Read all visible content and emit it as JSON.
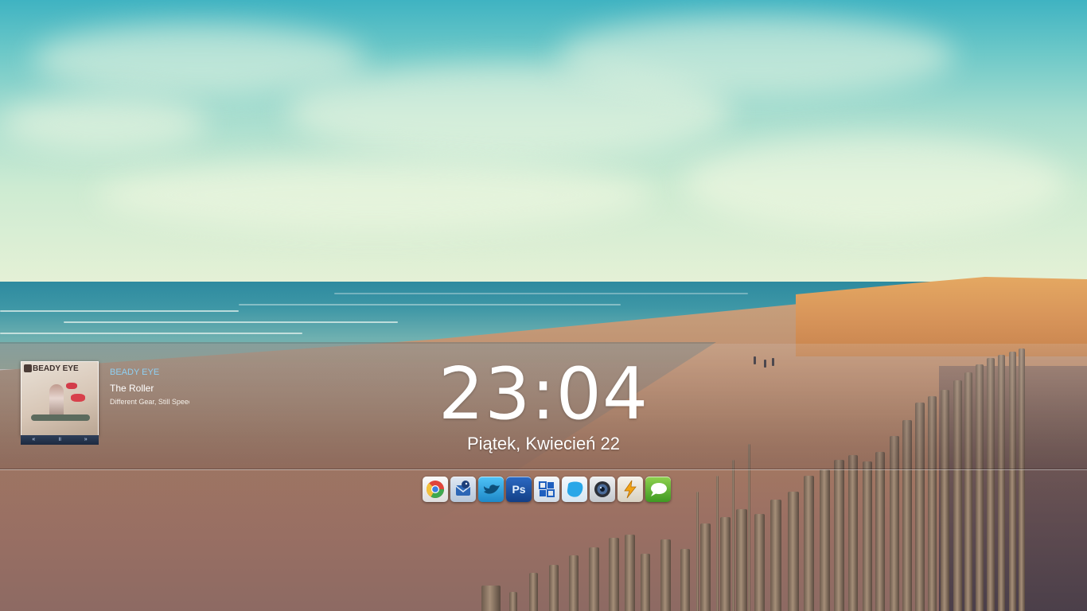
{
  "clock": {
    "time": "23:04",
    "date": "Piątek, Kwiecień 22"
  },
  "music_player": {
    "artist": "BEADY EYE",
    "title": "The Roller",
    "album": "Different Gear, Still Speeding",
    "album_art_text": "BEADY EYE",
    "controls": {
      "previous": "«",
      "play_pause": "॥",
      "next": "»"
    }
  },
  "dock": {
    "apps": [
      {
        "icon": "chrome-icon",
        "label": "Google Chrome"
      },
      {
        "icon": "thunderbird-icon",
        "label": "Thunderbird"
      },
      {
        "icon": "twitter-bird-icon",
        "label": "Twitter"
      },
      {
        "icon": "photoshop-icon",
        "label": "Ps"
      },
      {
        "icon": "windows-icon",
        "label": "Windows"
      },
      {
        "icon": "skype-icon",
        "label": "Skype"
      },
      {
        "icon": "camera-icon",
        "label": "Camera"
      },
      {
        "icon": "winamp-icon",
        "label": "Winamp"
      },
      {
        "icon": "messages-icon",
        "label": "Messages"
      }
    ]
  },
  "colors": {
    "artist_text": "#8fd0f3",
    "player_bar": "#1d2a40"
  }
}
